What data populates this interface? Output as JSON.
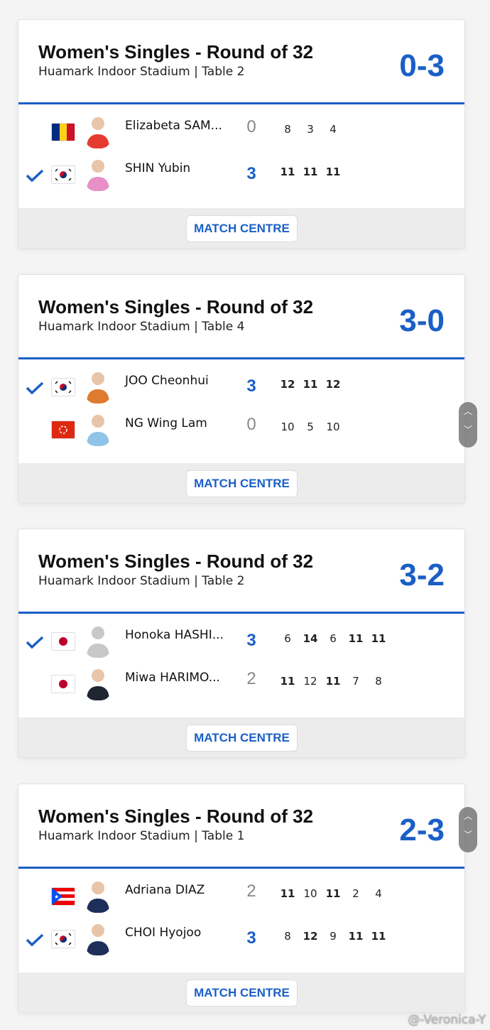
{
  "colors": {
    "accent": "#1a5fc6",
    "footer": "#ececec"
  },
  "matches": [
    {
      "title": "Women's Singles - Round of 32",
      "venue": "Huamark Indoor Stadium | Table 2",
      "final": "0-3",
      "button": "MATCH CENTRE",
      "players": [
        {
          "name": "Elizabeta SAM...",
          "flag": "ROU",
          "winner": false,
          "sets": "0",
          "avatar": "#e53b2f",
          "games": [
            {
              "v": "8",
              "b": false
            },
            {
              "v": "3",
              "b": false
            },
            {
              "v": "4",
              "b": false
            }
          ]
        },
        {
          "name": "SHIN Yubin",
          "flag": "KOR",
          "winner": true,
          "sets": "3",
          "avatar": "#e88fc8",
          "games": [
            {
              "v": "11",
              "b": true
            },
            {
              "v": "11",
              "b": true
            },
            {
              "v": "11",
              "b": true
            }
          ]
        }
      ]
    },
    {
      "title": "Women's Singles - Round of 32",
      "venue": "Huamark Indoor Stadium | Table 4",
      "final": "3-0",
      "button": "MATCH CENTRE",
      "players": [
        {
          "name": "JOO Cheonhui",
          "flag": "KOR",
          "winner": true,
          "sets": "3",
          "avatar": "#e07a30",
          "games": [
            {
              "v": "12",
              "b": true
            },
            {
              "v": "11",
              "b": true
            },
            {
              "v": "12",
              "b": true
            }
          ]
        },
        {
          "name": "NG Wing Lam",
          "flag": "HKG",
          "winner": false,
          "sets": "0",
          "avatar": "#8fc3e8",
          "games": [
            {
              "v": "10",
              "b": false
            },
            {
              "v": "5",
              "b": false
            },
            {
              "v": "10",
              "b": false
            }
          ]
        }
      ]
    },
    {
      "title": "Women's Singles - Round of 32",
      "venue": "Huamark Indoor Stadium | Table 2",
      "final": "3-2",
      "button": "MATCH CENTRE",
      "players": [
        {
          "name": "Honoka HASHI...",
          "flag": "JPN",
          "winner": true,
          "sets": "3",
          "avatar": "#c8c8c8",
          "games": [
            {
              "v": "6",
              "b": false
            },
            {
              "v": "14",
              "b": true
            },
            {
              "v": "6",
              "b": false
            },
            {
              "v": "11",
              "b": true
            },
            {
              "v": "11",
              "b": true
            }
          ]
        },
        {
          "name": "Miwa HARIMO...",
          "flag": "JPN",
          "winner": false,
          "sets": "2",
          "avatar": "#1e2530",
          "games": [
            {
              "v": "11",
              "b": true
            },
            {
              "v": "12",
              "b": false
            },
            {
              "v": "11",
              "b": true
            },
            {
              "v": "7",
              "b": false
            },
            {
              "v": "8",
              "b": false
            }
          ]
        }
      ]
    },
    {
      "title": "Women's Singles - Round of 32",
      "venue": "Huamark Indoor Stadium | Table 1",
      "final": "2-3",
      "button": "MATCH CENTRE",
      "players": [
        {
          "name": "Adriana DIAZ",
          "flag": "PUR",
          "winner": false,
          "sets": "2",
          "avatar": "#1e2f5c",
          "games": [
            {
              "v": "11",
              "b": true
            },
            {
              "v": "10",
              "b": false
            },
            {
              "v": "11",
              "b": true
            },
            {
              "v": "2",
              "b": false
            },
            {
              "v": "4",
              "b": false
            }
          ]
        },
        {
          "name": "CHOI Hyojoo",
          "flag": "KOR",
          "winner": true,
          "sets": "3",
          "avatar": "#1e2f5c",
          "games": [
            {
              "v": "8",
              "b": false
            },
            {
              "v": "12",
              "b": true
            },
            {
              "v": "9",
              "b": false
            },
            {
              "v": "11",
              "b": true
            },
            {
              "v": "11",
              "b": true
            }
          ]
        }
      ]
    }
  ],
  "scroll_icons": [
    "chevron-up-icon",
    "chevron-down-icon"
  ],
  "watermark": "@-Veronica-Y"
}
